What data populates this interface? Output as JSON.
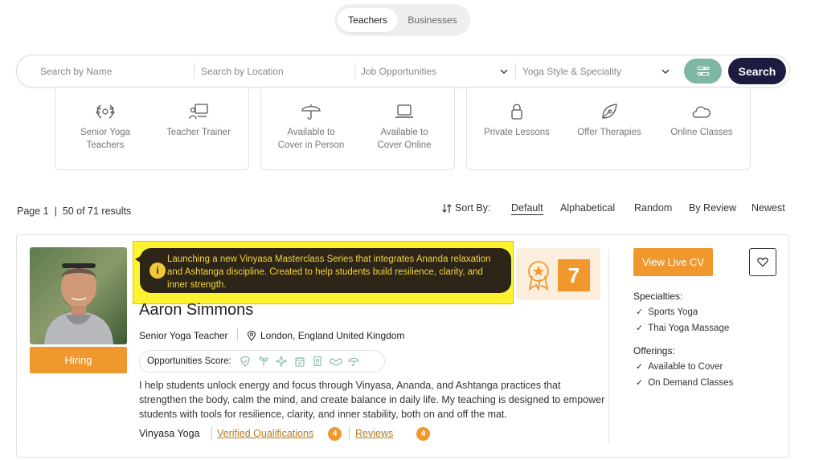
{
  "tabs": [
    {
      "label": "Teachers",
      "active": true
    },
    {
      "label": "Businesses",
      "active": false
    }
  ],
  "search": {
    "name_placeholder": "Search by Name",
    "location_placeholder": "Search by Location",
    "job_select": "Job Opportunities",
    "style_select": "Yoga Style & Speciality",
    "button_label": "Search",
    "filter_icon": "sliders-icon",
    "filter_color": "#7fb7a5",
    "button_color": "#1d1b3f"
  },
  "categories": [
    {
      "items": [
        {
          "label_line1": "Senior Yoga",
          "label_line2": "Teachers",
          "icon": "laurel-wreath-icon"
        },
        {
          "label_line1": "Teacher Trainer",
          "label_line2": "",
          "icon": "presenter-board-icon"
        }
      ]
    },
    {
      "items": [
        {
          "label_line1": "Available to",
          "label_line2": "Cover in Person",
          "icon": "umbrella-icon"
        },
        {
          "label_line1": "Available to",
          "label_line2": "Cover Online",
          "icon": "laptop-icon"
        }
      ]
    },
    {
      "items": [
        {
          "label_line1": "Private Lessons",
          "label_line2": "",
          "icon": "lock-icon"
        },
        {
          "label_line1": "Offer Therapies",
          "label_line2": "",
          "icon": "leaf-icon"
        },
        {
          "label_line1": "Online Classes",
          "label_line2": "",
          "icon": "cloud-icon"
        }
      ]
    }
  ],
  "results": {
    "text": "Page 1  |  50 of 71 results"
  },
  "sort": {
    "label": "Sort By:",
    "options": [
      "Default",
      "Alphabetical",
      "Random",
      "By Review",
      "Newest"
    ],
    "active": "Default"
  },
  "teacher": {
    "name": "Aaron Simmons",
    "role": "Senior Yoga Teacher",
    "location": "London, England United Kingdom",
    "hiring_label": "Hiring",
    "announcement": "Launching a new Vinyasa Masterclass Series that integrates Ananda relaxation and Ashtanga discipline. Created to help students build resilience, clarity, and inner strength.",
    "score": "7",
    "opportunities_label": "Opportunities Score:",
    "opportunity_icons": [
      "shield-icon",
      "sprout-icon",
      "sparkle-icon",
      "calendar-icon",
      "badge-icon",
      "handshake-icon",
      "umbrella-icon"
    ],
    "bio": "I help students unlock energy and focus through Vinyasa, Ananda, and Ashtanga practices that strengthen the body, calm the mind, and create balance in daily life. My teaching is designed to empower students with tools for resilience, clarity, and inner stability, both on and off the mat.",
    "style": "Vinyasa Yoga",
    "qualifications_label": "Verified Qualifications",
    "qualifications_count": "4",
    "reviews_label": "Reviews",
    "reviews_count": "4",
    "cv_button": "View Live CV",
    "specialties_label": "Specialties:",
    "specialties": [
      "Sports Yoga",
      "Thai Yoga Massage"
    ],
    "offerings_label": "Offerings:",
    "offerings": [
      "Available to Cover",
      "On Demand Classes"
    ],
    "accent_color": "#f0982e",
    "highlight_color": "#fff330"
  }
}
